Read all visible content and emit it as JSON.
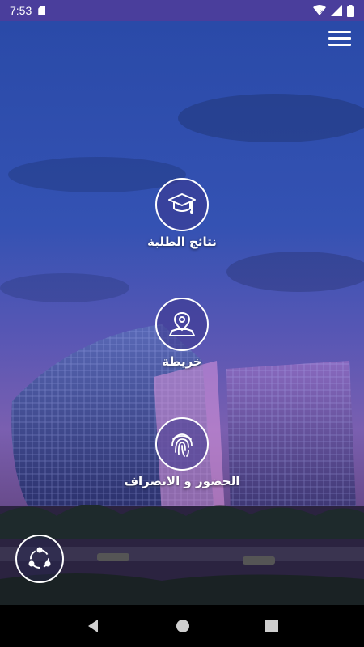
{
  "status_bar": {
    "time": "7:53",
    "icons": [
      "sd-card-icon",
      "wifi-icon",
      "signal-icon",
      "battery-icon"
    ]
  },
  "menu": {
    "icon": "hamburger-menu-icon"
  },
  "nav_items": [
    {
      "label": "نتائج الطلبة",
      "icon": "graduation-cap-icon"
    },
    {
      "label": "خريطة",
      "icon": "map-pin-icon"
    },
    {
      "label": "الحضور و الانصراف",
      "icon": "fingerprint-icon"
    }
  ],
  "share": {
    "icon": "share-icon"
  },
  "system_nav": {
    "buttons": [
      "back-icon",
      "home-icon",
      "recents-icon"
    ]
  },
  "colors": {
    "status_bar": "#4a3e9c",
    "sky_top": "#2a4aa8",
    "sky_dusk": "#7a5fb0",
    "nav_bar": "#000000"
  }
}
